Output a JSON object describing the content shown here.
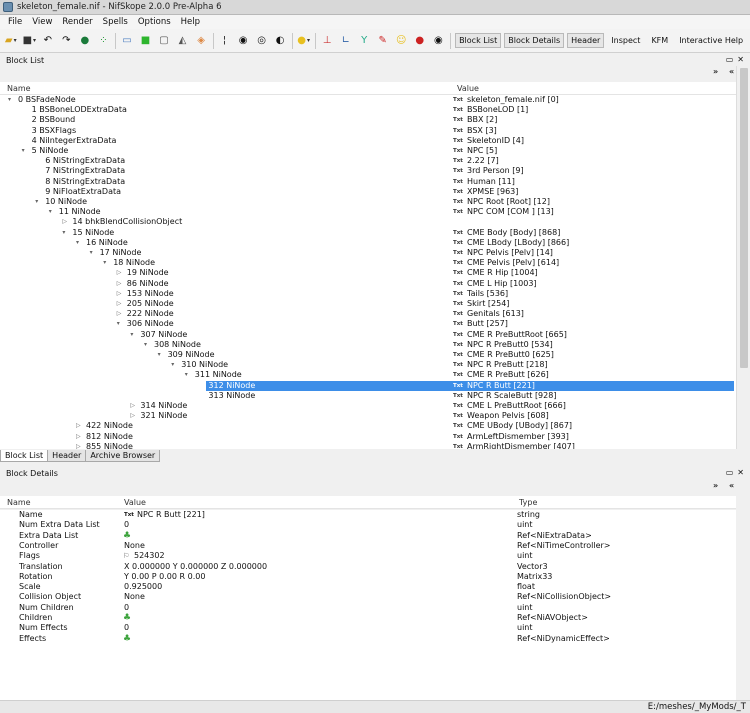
{
  "window": {
    "title": "skeleton_female.nif - NifSkope 2.0.0 Pre-Alpha 6"
  },
  "menu": [
    "File",
    "View",
    "Render",
    "Spells",
    "Options",
    "Help"
  ],
  "toolbar": {
    "text_buttons": [
      "Block List",
      "Block Details",
      "Header",
      "Inspect",
      "KFM",
      "Interactive Help"
    ]
  },
  "block_list": {
    "title": "Block List",
    "col_name": "Name",
    "col_value": "Value",
    "rows": [
      {
        "n": "0 BSFadeNode",
        "v": "skeleton_female.nif [0]",
        "lvl": 0,
        "a": "▾"
      },
      {
        "n": "1 BSBoneLODExtraData",
        "v": "BSBoneLOD [1]",
        "lvl": 1,
        "a": ""
      },
      {
        "n": "2 BSBound",
        "v": "BBX [2]",
        "lvl": 1,
        "a": ""
      },
      {
        "n": "3 BSXFlags",
        "v": "BSX [3]",
        "lvl": 1,
        "a": ""
      },
      {
        "n": "4 NiIntegerExtraData",
        "v": "SkeletonID [4]",
        "lvl": 1,
        "a": ""
      },
      {
        "n": "5 NiNode",
        "v": "NPC [5]",
        "lvl": 1,
        "a": "▾"
      },
      {
        "n": "6 NiStringExtraData",
        "v": "2.22 [7]",
        "lvl": 2,
        "a": ""
      },
      {
        "n": "7 NiStringExtraData",
        "v": "3rd Person [9]",
        "lvl": 2,
        "a": ""
      },
      {
        "n": "8 NiStringExtraData",
        "v": "Human [11]",
        "lvl": 2,
        "a": ""
      },
      {
        "n": "9 NiFloatExtraData",
        "v": "XPMSE [963]",
        "lvl": 2,
        "a": ""
      },
      {
        "n": "10 NiNode",
        "v": "NPC Root [Root] [12]",
        "lvl": 2,
        "a": "▾"
      },
      {
        "n": "11 NiNode",
        "v": "NPC COM [COM ] [13]",
        "lvl": 3,
        "a": "▾"
      },
      {
        "n": "14 bhkBlendCollisionObject",
        "v": "",
        "lvl": 4,
        "a": "▷"
      },
      {
        "n": "15 NiNode",
        "v": "CME Body [Body] [868]",
        "lvl": 4,
        "a": "▾"
      },
      {
        "n": "16 NiNode",
        "v": "CME LBody [LBody] [866]",
        "lvl": 5,
        "a": "▾"
      },
      {
        "n": "17 NiNode",
        "v": "NPC Pelvis [Pelv] [14]",
        "lvl": 6,
        "a": "▾"
      },
      {
        "n": "18 NiNode",
        "v": "CME Pelvis [Pelv] [614]",
        "lvl": 7,
        "a": "▾"
      },
      {
        "n": "19 NiNode",
        "v": "CME R Hip [1004]",
        "lvl": 8,
        "a": "▷"
      },
      {
        "n": "86 NiNode",
        "v": "CME L Hip [1003]",
        "lvl": 8,
        "a": "▷"
      },
      {
        "n": "153 NiNode",
        "v": "Tails [536]",
        "lvl": 8,
        "a": "▷"
      },
      {
        "n": "205 NiNode",
        "v": "Skirt [254]",
        "lvl": 8,
        "a": "▷"
      },
      {
        "n": "222 NiNode",
        "v": "Genitals [613]",
        "lvl": 8,
        "a": "▷"
      },
      {
        "n": "306 NiNode",
        "v": "Butt [257]",
        "lvl": 8,
        "a": "▾"
      },
      {
        "n": "307 NiNode",
        "v": "CME R PreButtRoot [665]",
        "lvl": 9,
        "a": "▾"
      },
      {
        "n": "308 NiNode",
        "v": "NPC R PreButt0 [534]",
        "lvl": 10,
        "a": "▾"
      },
      {
        "n": "309 NiNode",
        "v": "CME R PreButt0 [625]",
        "lvl": 11,
        "a": "▾"
      },
      {
        "n": "310 NiNode",
        "v": "NPC R PreButt [218]",
        "lvl": 12,
        "a": "▾"
      },
      {
        "n": "311 NiNode",
        "v": "CME R PreButt [626]",
        "lvl": 13,
        "a": "▾"
      },
      {
        "n": "312 NiNode",
        "v": "NPC R Butt [221]",
        "lvl": 14,
        "a": "",
        "sel": true
      },
      {
        "n": "313 NiNode",
        "v": "NPC R ScaleButt [928]",
        "lvl": 14,
        "a": ""
      },
      {
        "n": "314 NiNode",
        "v": "CME L PreButtRoot [666]",
        "lvl": 9,
        "a": "▷"
      },
      {
        "n": "321 NiNode",
        "v": "Weapon Pelvis [608]",
        "lvl": 9,
        "a": "▷"
      },
      {
        "n": "422 NiNode",
        "v": "CME UBody [UBody] [867]",
        "lvl": 5,
        "a": "▷"
      },
      {
        "n": "812 NiNode",
        "v": "ArmLeftDismember [393]",
        "lvl": 5,
        "a": "▷"
      },
      {
        "n": "855 NiNode",
        "v": "ArmRightDismember [407]",
        "lvl": 5,
        "a": "▷"
      }
    ]
  },
  "bottom_tabs": [
    "Block List",
    "Header",
    "Archive Browser"
  ],
  "block_details": {
    "title": "Block Details",
    "col_name": "Name",
    "col_value": "Value",
    "col_type": "Type",
    "rows": [
      {
        "n": "Name",
        "v": "NPC R Butt [221]",
        "t": "string",
        "icon": "txt"
      },
      {
        "n": "Num Extra Data List",
        "v": "0",
        "t": "uint",
        "icon": ""
      },
      {
        "n": "Extra Data List",
        "v": "",
        "t": "Ref<NiExtraData>",
        "icon": "link"
      },
      {
        "n": "Controller",
        "v": "None",
        "t": "Ref<NiTimeController>",
        "icon": ""
      },
      {
        "n": "Flags",
        "v": "524302",
        "t": "uint",
        "icon": "flag"
      },
      {
        "n": "Translation",
        "v": "X 0.000000 Y 0.000000 Z 0.000000",
        "t": "Vector3",
        "icon": ""
      },
      {
        "n": "Rotation",
        "v": "Y 0.00 P 0.00 R 0.00",
        "t": "Matrix33",
        "icon": ""
      },
      {
        "n": "Scale",
        "v": "0.925000",
        "t": "float",
        "icon": ""
      },
      {
        "n": "Collision Object",
        "v": "None",
        "t": "Ref<NiCollisionObject>",
        "icon": ""
      },
      {
        "n": "Num Children",
        "v": "0",
        "t": "uint",
        "icon": ""
      },
      {
        "n": "Children",
        "v": "",
        "t": "Ref<NiAVObject>",
        "icon": "link"
      },
      {
        "n": "Num Effects",
        "v": "0",
        "t": "uint",
        "icon": ""
      },
      {
        "n": "Effects",
        "v": "",
        "t": "Ref<NiDynamicEffect>",
        "icon": "link"
      }
    ]
  },
  "status": {
    "path": "E:/meshes/_MyMods/_T"
  },
  "txt_badge": "Txt",
  "colors": {
    "selection": "#3d8ee8",
    "link_icon": "#3ca33c"
  }
}
